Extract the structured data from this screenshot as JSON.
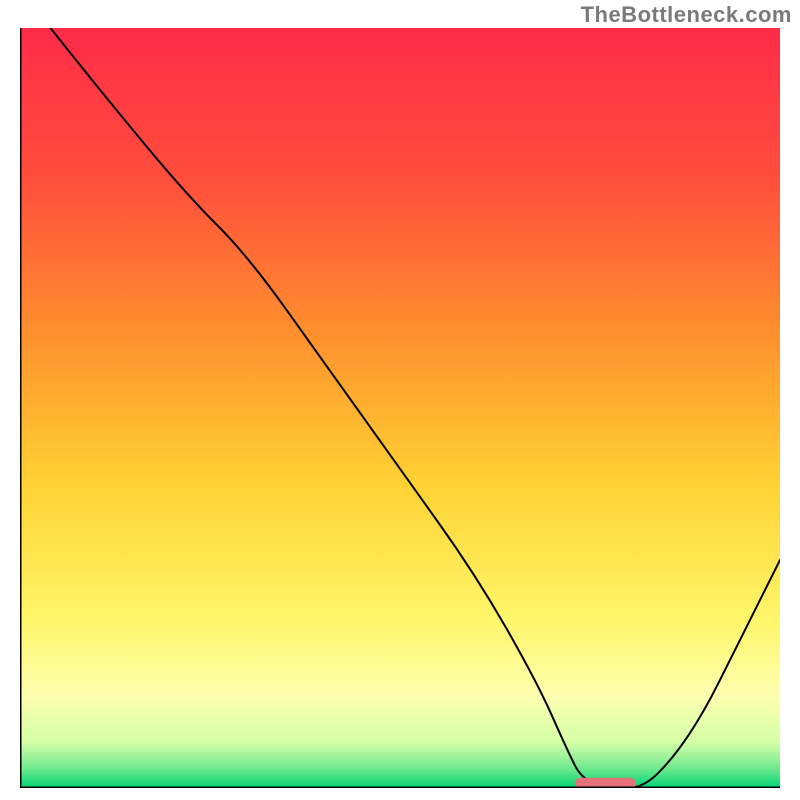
{
  "watermark": "TheBottleneck.com",
  "chart_data": {
    "type": "line",
    "title": "",
    "xlabel": "",
    "ylabel": "",
    "xlim": [
      0,
      100
    ],
    "ylim": [
      0,
      100
    ],
    "grid": false,
    "legend": false,
    "background_gradient": {
      "type": "vertical",
      "stops": [
        {
          "offset": 0.0,
          "color": "#ff2b48"
        },
        {
          "offset": 0.2,
          "color": "#ff4e3c"
        },
        {
          "offset": 0.4,
          "color": "#ff8f2d"
        },
        {
          "offset": 0.6,
          "color": "#ffd233"
        },
        {
          "offset": 0.78,
          "color": "#fff66a"
        },
        {
          "offset": 0.88,
          "color": "#fdffb0"
        },
        {
          "offset": 0.94,
          "color": "#d4ffa6"
        },
        {
          "offset": 0.975,
          "color": "#6de88e"
        },
        {
          "offset": 1.0,
          "color": "#00d474"
        }
      ]
    },
    "series": [
      {
        "name": "bottleneck-curve",
        "color": "#000000",
        "stroke_width": 2,
        "x": [
          4,
          12,
          22,
          30,
          40,
          50,
          60,
          68,
          72,
          74,
          78,
          82,
          86,
          90,
          94,
          100
        ],
        "y": [
          100,
          90,
          78,
          70,
          56,
          42,
          28,
          14,
          5,
          1,
          0,
          0,
          4,
          10,
          18,
          30
        ]
      }
    ],
    "marker": {
      "name": "optimum-pill",
      "shape": "rounded-rect",
      "color": "#e5717b",
      "x_center": 77,
      "y_center": 0.6,
      "width": 8,
      "height": 1.5,
      "rx": 0.75
    },
    "axes": {
      "left": {
        "visible": true,
        "color": "#000000",
        "width": 3
      },
      "bottom": {
        "visible": true,
        "color": "#000000",
        "width": 3
      },
      "right": {
        "visible": false
      },
      "top": {
        "visible": false
      }
    }
  }
}
